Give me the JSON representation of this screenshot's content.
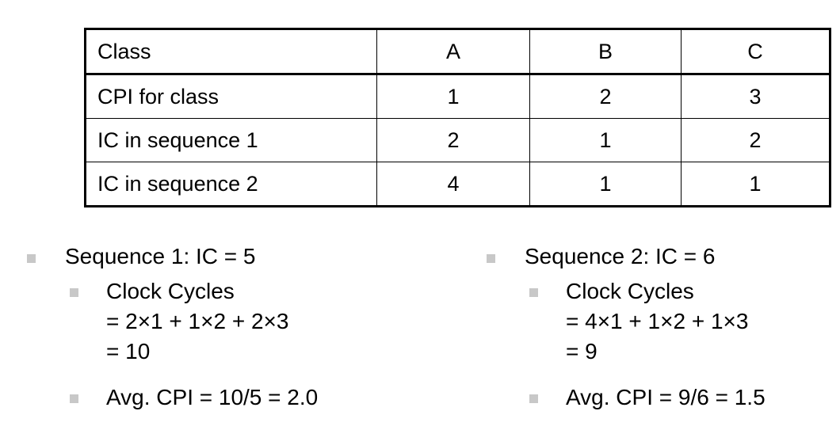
{
  "slide": {
    "table": {
      "columns": [
        "Class",
        "A",
        "B",
        "C"
      ],
      "rows": [
        {
          "label": "Class",
          "a": "A",
          "b": "B",
          "c": "C",
          "is_header": true
        },
        {
          "label": "CPI for class",
          "a": "1",
          "b": "2",
          "c": "3",
          "is_header": false
        },
        {
          "label": "IC in sequence 1",
          "a": "2",
          "b": "1",
          "c": "2",
          "is_header": false
        },
        {
          "label": "IC in sequence 2",
          "a": "4",
          "b": "1",
          "c": "1",
          "is_header": false
        }
      ]
    },
    "bullets": {
      "left": {
        "heading": "Sequence 1: IC = 5",
        "clock_cycles_label": "Clock Cycles\n= 2×1 + 1×2 + 2×3\n= 10",
        "avg_cpi": "Avg. CPI = 10/5 = 2.0"
      },
      "right": {
        "heading": "Sequence 2: IC = 6",
        "clock_cycles_label": "Clock Cycles\n= 4×1 + 1×2 + 1×3\n= 9",
        "avg_cpi": "Avg. CPI = 9/6 = 1.5"
      }
    },
    "colors": {
      "text": "#000000",
      "bullet_marker": "#c8c8c8",
      "table_border": "#000000",
      "background": "#ffffff"
    }
  }
}
